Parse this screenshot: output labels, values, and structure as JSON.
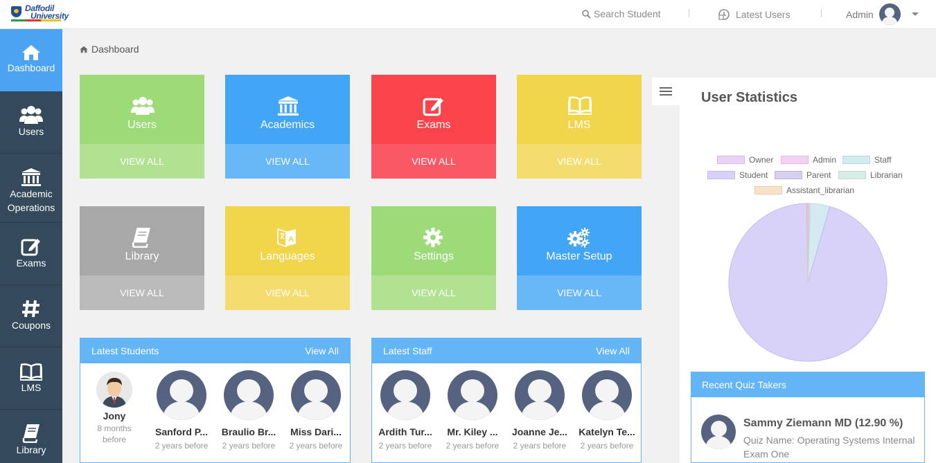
{
  "logo": {
    "line1": "Daffodil",
    "line2": "University"
  },
  "topbar": {
    "search_label": "Search Student",
    "latest_users_label": "Latest Users",
    "admin_label": "Admin"
  },
  "sidebar": {
    "items": [
      {
        "label": "Dashboard"
      },
      {
        "label": "Users"
      },
      {
        "label": "Academic Operations"
      },
      {
        "label": "Exams"
      },
      {
        "label": "Coupons"
      },
      {
        "label": "LMS"
      },
      {
        "label": "Library"
      }
    ]
  },
  "breadcrumb": {
    "label": "Dashboard"
  },
  "tiles": [
    {
      "label": "Users",
      "action": "VIEW ALL",
      "color": "#9ddb79",
      "color_bottom": "#b0e291",
      "icon": "users-icon"
    },
    {
      "label": "Academics",
      "action": "VIEW ALL",
      "color": "#42a5f5",
      "color_bottom": "#68b7f7",
      "icon": "university-icon"
    },
    {
      "label": "Exams",
      "action": "VIEW ALL",
      "color": "#fa434a",
      "color_bottom": "#fa5865",
      "icon": "edit-icon"
    },
    {
      "label": "LMS",
      "action": "VIEW ALL",
      "color": "#f1d54a",
      "color_bottom": "#f4dc6f",
      "icon": "book-open-icon"
    },
    {
      "label": "Library",
      "action": "VIEW ALL",
      "color": "#a8a8a8",
      "color_bottom": "#bababa",
      "icon": "book-icon"
    },
    {
      "label": "Languages",
      "action": "VIEW ALL",
      "color": "#f1d54a",
      "color_bottom": "#f4dc6f",
      "icon": "language-icon"
    },
    {
      "label": "Settings",
      "action": "VIEW ALL",
      "color": "#9ddb79",
      "color_bottom": "#b0e291",
      "icon": "gear-icon"
    },
    {
      "label": "Master Setup",
      "action": "VIEW ALL",
      "color": "#42a5f5",
      "color_bottom": "#68b7f7",
      "icon": "gears-icon"
    }
  ],
  "latest_students": {
    "title": "Latest Students",
    "view_all": "View All",
    "people": [
      {
        "name": "Jony",
        "time": "8 months before",
        "photo": true
      },
      {
        "name": "Sanford P...",
        "time": "2 years before"
      },
      {
        "name": "Braulio Br...",
        "time": "2 years before"
      },
      {
        "name": "Miss Dari...",
        "time": "2 years before"
      }
    ]
  },
  "latest_staff": {
    "title": "Latest Staff",
    "view_all": "View All",
    "people": [
      {
        "name": "Ardith Tur...",
        "time": "2 years before"
      },
      {
        "name": "Mr. Kiley ...",
        "time": "2 years before"
      },
      {
        "name": "Joanne Je...",
        "time": "2 years before"
      },
      {
        "name": "Katelyn Te...",
        "time": "2 years before"
      }
    ]
  },
  "user_statistics": {
    "title": "User Statistics"
  },
  "chart_data": {
    "type": "pie",
    "title": "User Statistics",
    "legend_placement": "top",
    "categories": [
      "Owner",
      "Admin",
      "Staff",
      "Student",
      "Parent",
      "Librarian",
      "Assistant_librarian"
    ],
    "values": [
      0.2,
      0.3,
      4,
      95.3,
      0.1,
      0.05,
      0.05
    ],
    "colors": [
      "#e8d2f7",
      "#f3d1f3",
      "#d2eaf0",
      "#d9d2f8",
      "#d6cff0",
      "#d9ece5",
      "#f7e1c9"
    ],
    "border_colors": [
      "#d6b7f0",
      "#e6b3ea",
      "#b7dce6",
      "#c5b9f2",
      "#bfb3e6",
      "#bfdcd1",
      "#ecc9a3"
    ]
  },
  "recent_quiz": {
    "title": "Recent Quiz Takers",
    "name": "Sammy Ziemann MD (12.90 %)",
    "info": "Quiz Name: Operating Systems Internal Exam One"
  }
}
